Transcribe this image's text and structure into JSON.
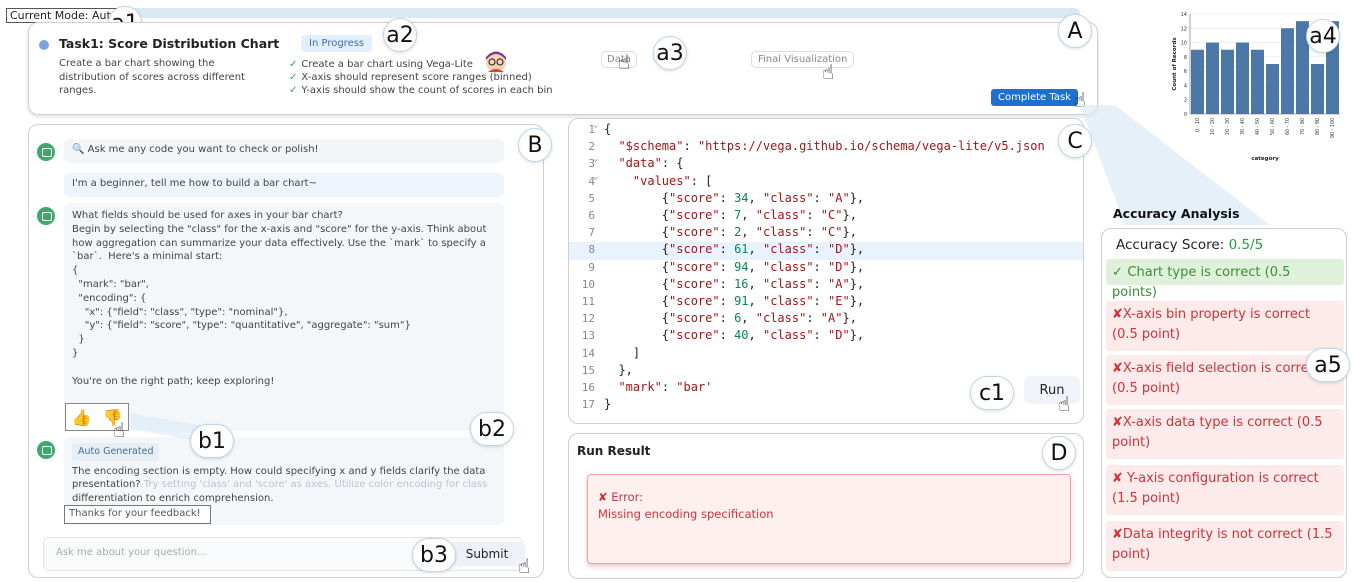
{
  "header": {
    "mode": "Current Mode: Auto",
    "task_title": "Task1: Score Distribution Chart",
    "task_desc": "Create a bar chart showing the distribution of scores across different ranges.",
    "status": "In Progress",
    "checklist": [
      "Create a bar chart using Vega-Lite",
      "X-axis should represent score ranges (binned)",
      "Y-axis should show the count of scores in each bin"
    ],
    "tab_data": "Data",
    "tab_final": "Final Visualization",
    "complete_label": "Complete Task"
  },
  "callouts": {
    "A": "A",
    "B": "B",
    "C": "C",
    "D": "D",
    "a1": "a1",
    "a2": "a2",
    "a3": "a3",
    "a4": "a4",
    "a5": "a5",
    "b1": "b1",
    "b2": "b2",
    "b3": "b3",
    "c1": "c1"
  },
  "chat": {
    "search_placeholder": "Ask me any code you want to check or polish!",
    "user_message": "I'm a beginner, tell me how to build a bar chart~",
    "bot_message": "What fields should be used for axes in your bar chart?\nBegin by selecting the \"class\" for the x-axis and \"score\" for the y-axis. Think about\nhow aggregation can summarize your data effectively. Use the `mark` to specify a\n`bar`.  Here's a minimal start:\n{\n  \"mark\": \"bar\",\n  \"encoding\": {\n    \"x\": {\"field\": \"class\", \"type\": \"nominal\"},\n    \"y\": {\"field\": \"score\", \"type\": \"quantitative\", \"aggregate\": \"sum\"}\n  }\n}\n\nYou're on the right path; keep exploring!",
    "auto_badge": "Auto Generated",
    "bot_message2_line1": "The encoding section is empty. How could specifying x and y fields clarify the data",
    "bot_message2_line2a": "presentation?",
    "bot_message2_line2b": " Try setting 'class' and 'score' as axes. Utilize color encoding for class",
    "bot_message2_line3": "differentiation to enrich comprehension.",
    "feedback": "Thanks for your feedback!",
    "ask_placeholder": "Ask me about your question...",
    "submit_label": "Submit"
  },
  "code": {
    "lines": [
      {
        "n": "1",
        "fold": true
      },
      {
        "n": "2"
      },
      {
        "n": "3",
        "fold": true
      },
      {
        "n": "4",
        "fold": true
      },
      {
        "n": "5"
      },
      {
        "n": "6"
      },
      {
        "n": "7"
      },
      {
        "n": "8"
      },
      {
        "n": "9"
      },
      {
        "n": "10"
      },
      {
        "n": "11"
      },
      {
        "n": "12"
      },
      {
        "n": "13"
      },
      {
        "n": "14"
      },
      {
        "n": "15"
      },
      {
        "n": "16"
      },
      {
        "n": "17"
      }
    ],
    "schema_key": "\"$schema\"",
    "schema_url": "\"https://vega.github.io/schema/vega-lite/v5.json",
    "data_key": "\"data\"",
    "values_key": "\"values\"",
    "records": [
      {
        "score": "34",
        "class": "\"A\""
      },
      {
        "score": "7",
        "class": "\"C\""
      },
      {
        "score": "2",
        "class": "\"C\""
      },
      {
        "score": "61",
        "class": "\"D\""
      },
      {
        "score": "94",
        "class": "\"D\""
      },
      {
        "score": "16",
        "class": "\"A\""
      },
      {
        "score": "91",
        "class": "\"E\""
      },
      {
        "score": "6",
        "class": "\"A\""
      },
      {
        "score": "40",
        "class": "\"D\""
      }
    ],
    "mark_key": "\"mark\"",
    "mark_val": "\"bar'",
    "run_label": "Run"
  },
  "result": {
    "title": "Run Result",
    "error_label": "Error:",
    "error_msg": "Missing encoding specification"
  },
  "accuracy": {
    "title": "Accuracy Analysis",
    "score_label": "Accuracy Score: ",
    "score_value": "0.5/5",
    "items": [
      {
        "ok": true,
        "text": "Chart type is correct (0.5 points)"
      },
      {
        "ok": false,
        "text": "X-axis bin property is correct (0.5 point)"
      },
      {
        "ok": false,
        "text": "X-axis field selection is correct (0.5 point)"
      },
      {
        "ok": false,
        "text": "X-axis data type is correct (0.5 point)"
      },
      {
        "ok": false,
        "text": " Y-axis configuration is correct (1.5 point)"
      },
      {
        "ok": false,
        "text": "Data integrity is not correct (1.5 point)"
      }
    ]
  },
  "chart_data": {
    "type": "bar",
    "categories": [
      "0 - 10",
      "10 - 20",
      "20 - 30",
      "30 - 40",
      "40 - 50",
      "50 - 60",
      "60 - 70",
      "70 - 80",
      "80 - 90",
      "90 - 100"
    ],
    "values": [
      9,
      10,
      9,
      10,
      9,
      7,
      12,
      13,
      7,
      13
    ],
    "xlabel": "category",
    "ylabel": "Count of Records",
    "ylim": [
      0,
      14
    ],
    "yticks": [
      0,
      2,
      4,
      6,
      8,
      10,
      12,
      14
    ],
    "color": "#4c78a8"
  }
}
